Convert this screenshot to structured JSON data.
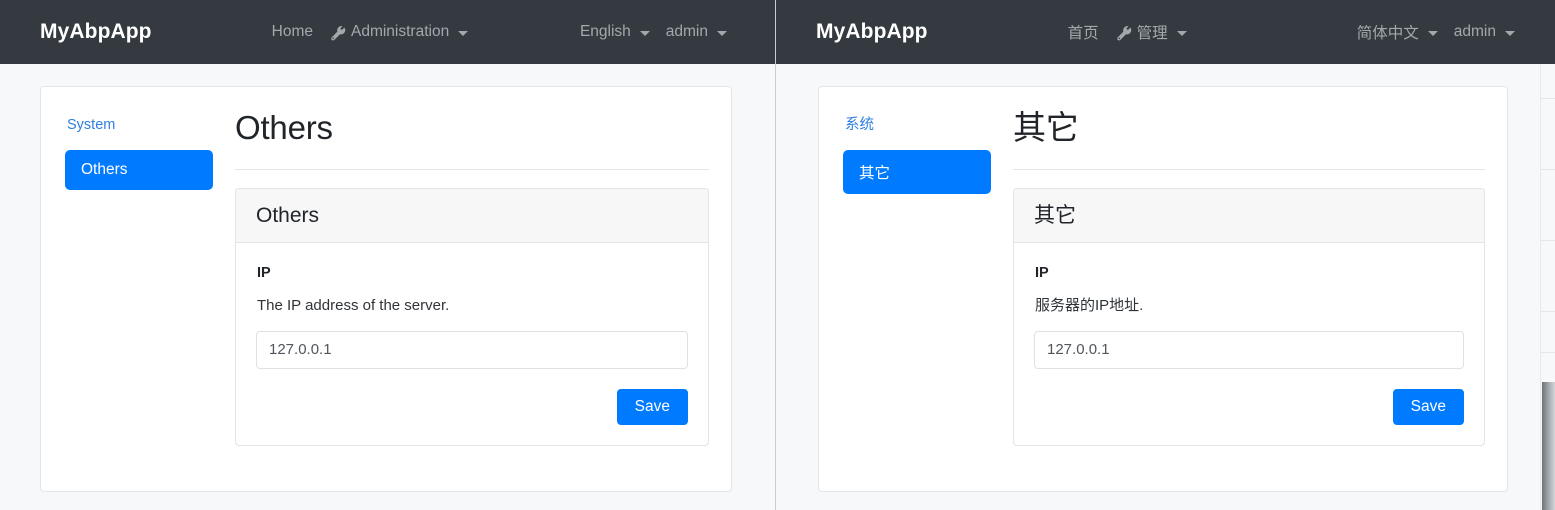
{
  "panels": [
    {
      "id": "english",
      "navbar": {
        "brand": "MyAbpApp",
        "links": [
          {
            "label": "Home",
            "icon": "",
            "caret": false
          },
          {
            "label": "Administration",
            "icon": "wrench-icon",
            "caret": true
          }
        ],
        "language": "English",
        "user": "admin"
      },
      "sidebar": {
        "group_label": "System",
        "active_item": "Others"
      },
      "page_title": "Others",
      "card": {
        "title": "Others",
        "field_label": "IP",
        "field_description": "The IP address of the server.",
        "input_value": "127.0.0.1",
        "input_placeholder": "127.0.0.1",
        "save_label": "Save"
      }
    },
    {
      "id": "chinese",
      "navbar": {
        "brand": "MyAbpApp",
        "links": [
          {
            "label": "首页",
            "icon": "",
            "caret": false
          },
          {
            "label": "管理",
            "icon": "wrench-icon",
            "caret": true
          }
        ],
        "language": "简体中文",
        "user": "admin"
      },
      "sidebar": {
        "group_label": "系统",
        "active_item": "其它"
      },
      "page_title": "其它",
      "card": {
        "title": "其它",
        "field_label": "IP",
        "field_description": "服务器的IP地址.",
        "input_value": "127.0.0.1",
        "input_placeholder": "127.0.0.1",
        "save_label": "Save"
      }
    }
  ],
  "colors": {
    "navbar_bg": "#343a40",
    "primary": "#007bff",
    "page_bg": "#f6f8fa",
    "link": "#2f7fe0",
    "nav_link": "#a3a8ad"
  }
}
